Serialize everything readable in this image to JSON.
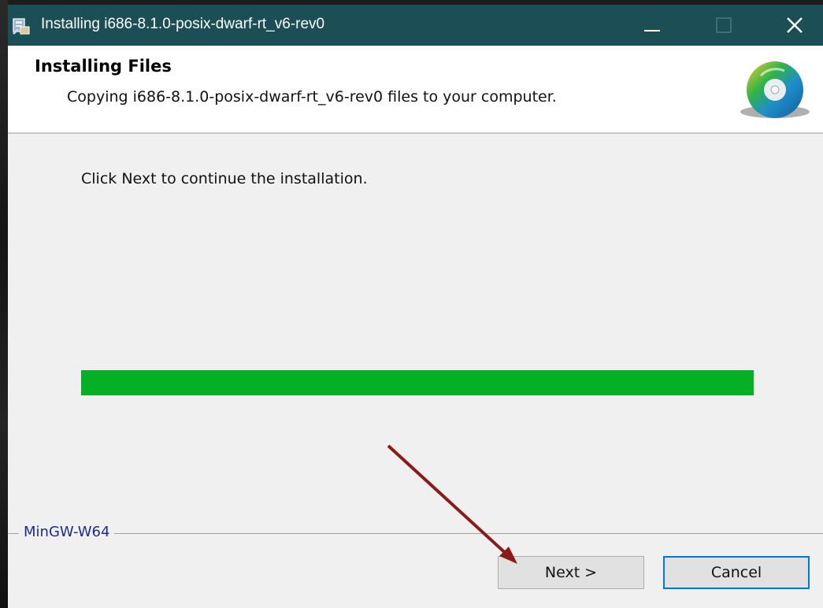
{
  "window": {
    "title": "Installing i686-8.1.0-posix-dwarf-rt_v6-rev0",
    "titlebar_color": "#1b4f55"
  },
  "titlebar": {
    "icons": {
      "app": "installer-package-icon",
      "minimize": "minimize-icon",
      "maximize": "maximize-icon",
      "close": "close-icon"
    }
  },
  "header": {
    "title": "Installing Files",
    "subtitle": "Copying i686-8.1.0-posix-dwarf-rt_v6-rev0 files to your computer.",
    "icon": "cd-disc-icon"
  },
  "main": {
    "instruction": "Click Next to continue the installation.",
    "progress": {
      "value": 1.0,
      "color": "#06b025"
    }
  },
  "footer": {
    "brand": "MinGW-W64",
    "next_label": "Next >",
    "cancel_label": "Cancel"
  },
  "annotation": {
    "type": "arrow",
    "color": "#8b1a1a",
    "points_to": "Next >"
  }
}
